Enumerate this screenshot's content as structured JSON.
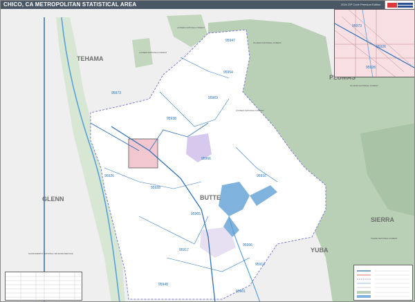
{
  "header": {
    "title": "CHICO, CA METROPOLITAN STATISTICAL AREA",
    "edition": "2024 ZIP Code Premium Edition"
  },
  "map": {
    "counties": [
      {
        "name": "TEHAMA"
      },
      {
        "name": "GLENN"
      },
      {
        "name": "BUTTE"
      },
      {
        "name": "SIERRA"
      },
      {
        "name": "YUBA"
      },
      {
        "name": "PLUMAS"
      }
    ],
    "zip_labels": [
      "95947",
      "95954",
      "95973",
      "95926",
      "95928",
      "95966",
      "95916",
      "95965",
      "95966",
      "95917",
      "95914",
      "95948",
      "95901",
      "95938",
      "95969"
    ],
    "forest_labels": [
      "LASSEN NATIONAL FOREST",
      "LASSEN NATIONAL FOREST",
      "LASSEN NATIONAL FOREST",
      "PLUMAS NATIONAL FOREST",
      "PLUMAS NATIONAL FOREST",
      "TAHOE NATIONAL FOREST",
      "SACRAMENTO NATIONAL WILDLIFE REFUGE"
    ],
    "inset_zips": [
      "95973",
      "95926",
      "95928"
    ]
  },
  "colors": {
    "land": "#f5f5f5",
    "msa": "#ffffff",
    "forest": "#b7cfb3",
    "water": "#7fb2dc",
    "river": "#58a0d8",
    "zip_line": "#2b78c8",
    "county_line": "#7b7bd0",
    "highway": "#2e6fb5",
    "urban_pink": "#f3c7cf",
    "urban_purple": "#d7c9ee",
    "title_bg": "#4a5866"
  }
}
